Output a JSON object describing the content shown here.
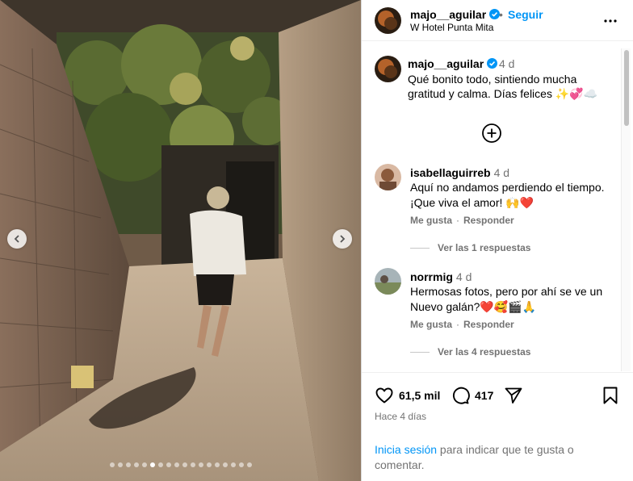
{
  "post": {
    "username": "majo__aguilar",
    "separator": "•",
    "follow_label": "Seguir",
    "location": "W Hotel Punta Mita",
    "caption_time": "4 d",
    "caption_text": "Qué bonito todo, sintiendo mucha gratitud y calma. Días felices ✨💞☁️"
  },
  "carousel": {
    "slide_count": 18,
    "active_index": 5
  },
  "comments": [
    {
      "username": "isabellaguirreb",
      "time": "4 d",
      "text": "Aquí no andamos perdiendo el tiempo. ¡Que viva el amor! 🙌❤️",
      "like_label": "Me gusta",
      "reply_label": "Responder",
      "dot": "·",
      "replies_label": "Ver las 1 respuestas"
    },
    {
      "username": "norrmig",
      "time": "4 d",
      "text": "Hermosas fotos, pero por ahí se ve un Nuevo galán?❤️🥰🎬🙏",
      "like_label": "Me gusta",
      "reply_label": "Responder",
      "dot": "·",
      "replies_label": "Ver las 4 respuestas"
    }
  ],
  "footer": {
    "likes": "61,5 mil",
    "comments_count": "417",
    "time_ago": "Hace 4 días",
    "login_link": "Inicia sesión",
    "login_text": " para indicar que te gusta o comentar."
  },
  "icons": {
    "verified": "verified-badge-icon",
    "more": "more-options-icon",
    "plus": "add-circle-icon",
    "like": "heart-icon",
    "comment": "comment-icon",
    "share": "paper-plane-icon",
    "save": "bookmark-icon",
    "prev": "chevron-left-icon",
    "next": "chevron-right-icon"
  },
  "colors": {
    "accent": "#0095f6",
    "secondary_text": "#737373",
    "verified": "#0095f6"
  }
}
